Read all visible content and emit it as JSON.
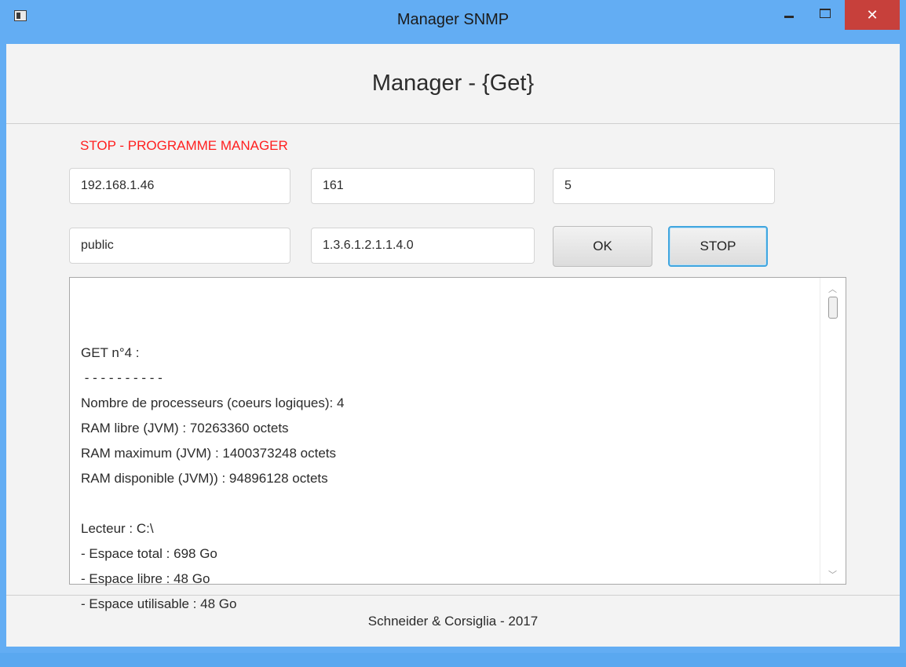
{
  "window": {
    "title": "Manager SNMP",
    "close_glyph": "✕"
  },
  "header": {
    "title": "Manager - {Get}"
  },
  "status": {
    "text": "STOP - PROGRAMME MANAGER",
    "color": "#ff1f1f"
  },
  "form": {
    "ip_value": "192.168.1.46",
    "port_value": "161",
    "count_value": "5",
    "community_value": "public",
    "oid_value": "1.3.6.1.2.1.1.4.0",
    "ok_label": "OK",
    "stop_label": "STOP"
  },
  "output": {
    "lines": [
      "GET n°4 :",
      " - - - - - - - - - -",
      "Nombre de processeurs (coeurs logiques): 4",
      "RAM libre (JVM) : 70263360 octets",
      "RAM maximum (JVM) : 1400373248 octets",
      "RAM disponible (JVM)) : 94896128 octets",
      "",
      "Lecteur : C:\\",
      "- Espace total : 698 Go",
      "- Espace libre : 48 Go",
      "- Espace utilisable : 48 Go"
    ]
  },
  "footer": {
    "text": "Schneider & Corsiglia - 2017"
  },
  "colors": {
    "titlebar": "#63adf3",
    "close_button": "#c7403b",
    "focus_ring": "#41a6df"
  },
  "icons": {
    "app": "app-window-icon",
    "minimize": "minimize-icon",
    "maximize": "maximize-icon",
    "close": "close-icon",
    "scroll_up": "chevron-up-icon",
    "scroll_down": "chevron-down-icon"
  }
}
